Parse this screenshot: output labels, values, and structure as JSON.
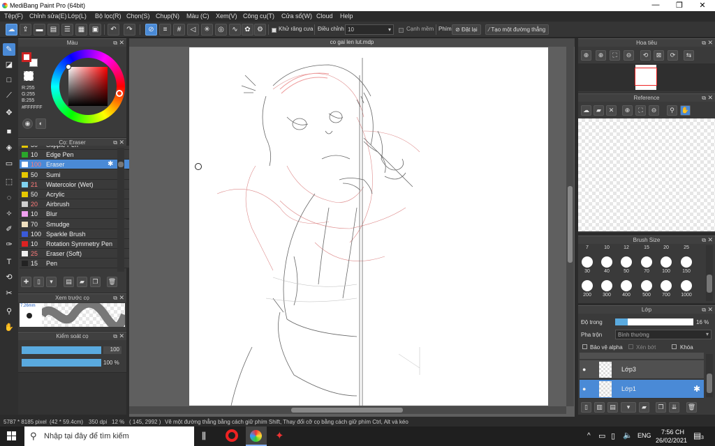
{
  "window": {
    "title": "MediBang Paint Pro (64bit)",
    "minimize": "—",
    "maximize": "❐",
    "close": "✕"
  },
  "menu": [
    "Tệp(F)",
    "Chỉnh sửa(E)",
    "Lớp(L)",
    "Bộ lọc(R)",
    "Chọn(S)",
    "Chụp(N)",
    "Màu (C)",
    "Xem(V)",
    "Công cụ(T)",
    "Cửa sổ(W)",
    "Cloud",
    "Help"
  ],
  "toolbar": {
    "antialias_label": "Khử răng cưa",
    "correction_label": "Điều chỉnh",
    "correction_value": "10",
    "edge_snap_label": "Cạnh mềm",
    "key_label": "Phím",
    "reset_label": "Đặt lại",
    "straight_line_label": "Tạo một đường thẳng"
  },
  "color_panel": {
    "title": "Màu",
    "r": "R:255",
    "g": "G:255",
    "b": "B:255",
    "hex": "#FFFFFF",
    "primary_color": "#cc2222",
    "secondary_color": "#ffffff"
  },
  "brush_panel": {
    "title": "Cọ: Eraser",
    "items": [
      {
        "size": "30",
        "name": "Stipple Pen",
        "color": "#e6c800",
        "red": false,
        "selected": false
      },
      {
        "size": "10",
        "name": "Edge Pen",
        "color": "#2aa82a",
        "red": false,
        "selected": false
      },
      {
        "size": "100",
        "name": "Eraser",
        "color": "#ffffff",
        "red": true,
        "selected": true
      },
      {
        "size": "50",
        "name": "Sumi",
        "color": "#e6c800",
        "red": false,
        "selected": false
      },
      {
        "size": "21",
        "name": "Watercolor (Wet)",
        "color": "#7fd3f0",
        "red": true,
        "selected": false
      },
      {
        "size": "50",
        "name": "Acrylic",
        "color": "#e6c800",
        "red": false,
        "selected": false
      },
      {
        "size": "20",
        "name": "Airbrush",
        "color": "#cfcfcf",
        "red": true,
        "selected": false
      },
      {
        "size": "10",
        "name": "Blur",
        "color": "#f0a0f0",
        "red": false,
        "selected": false
      },
      {
        "size": "70",
        "name": "Smudge",
        "color": "#f0e0c0",
        "red": false,
        "selected": false
      },
      {
        "size": "100",
        "name": "Sparkle Brush",
        "color": "#3a5ad8",
        "red": false,
        "selected": false
      },
      {
        "size": "10",
        "name": "Rotation Symmetry Pen",
        "color": "#dd2222",
        "red": false,
        "selected": false
      },
      {
        "size": "25",
        "name": "Eraser (Soft)",
        "color": "#f0f0f0",
        "red": true,
        "selected": false
      },
      {
        "size": "15",
        "name": "Pen",
        "color": "#222222",
        "red": false,
        "selected": false
      }
    ]
  },
  "preview_panel": {
    "title": "Xem trước cọ",
    "size": "7.26mm"
  },
  "control_panel": {
    "title": "Kiểm soát cọ",
    "size_value": "100",
    "opacity_value": "100 %",
    "size_fraction": 1.0,
    "opacity_fraction": 1.0
  },
  "document": {
    "tab_title": "co gai len lut.mdp"
  },
  "navigator": {
    "title": "Hoa tiêu"
  },
  "reference": {
    "title": "Reference"
  },
  "brush_size": {
    "title": "Brush Size",
    "top_labels": [
      "7",
      "10",
      "12",
      "15",
      "20",
      "25"
    ],
    "row1_labels": [
      "30",
      "40",
      "50",
      "70",
      "100",
      "150"
    ],
    "row2_labels": [
      "200",
      "300",
      "400",
      "500",
      "700",
      "1000"
    ]
  },
  "layer_panel": {
    "title": "Lớp",
    "opacity_label": "Độ trong",
    "opacity_value": "16 %",
    "opacity_fraction": 0.16,
    "blend_label": "Pha trộn",
    "blend_value": "Bình thường",
    "protect_alpha": "Bảo vệ alpha",
    "clipping": "Xén bớt",
    "lock": "Khóa",
    "layers": [
      {
        "name": "Lớp3",
        "selected": false
      },
      {
        "name": "Lớp1",
        "selected": true
      }
    ]
  },
  "status": {
    "dimensions": "5787 * 8185 pixel",
    "size_cm": "(42 * 59.4cm)",
    "dpi": "350 dpi",
    "zoom": "12 %",
    "cursor": "( 145, 2992 )",
    "hint": "Vẽ một đường thẳng bằng cách giữ phím Shift, Thay đổi cỡ cọ bằng cách giữ phím Ctrl, Alt và kéo"
  },
  "taskbar": {
    "search_placeholder": "Nhập tại đây để tìm kiếm",
    "language": "ENG",
    "time": "7:56 CH",
    "date": "26/02/2021",
    "notifications": "3"
  }
}
